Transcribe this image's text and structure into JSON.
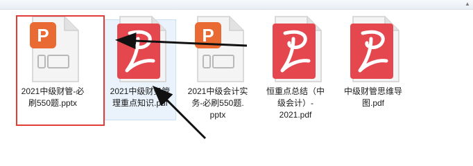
{
  "window": {
    "scroll_up_glyph": "▲"
  },
  "files": [
    {
      "name": "2021中级财管-必刷550题.pptx",
      "lines": [
        "2021中级财管-必",
        "刷550题.pptx"
      ],
      "icon": "pptx-file-icon",
      "icon_glyph": "P"
    },
    {
      "name": "2021中级财务管理重点知识.pdf",
      "lines": [
        "2021中级财务管",
        "理重点知识.pdf"
      ],
      "icon": "pdf-file-icon"
    },
    {
      "name": "2021中级会计实务-必刷550题.pptx",
      "lines": [
        "2021中级会计实",
        "务-必刷550题.",
        "pptx"
      ],
      "icon": "pptx-file-icon",
      "icon_glyph": "P"
    },
    {
      "name": "恒重点总结（中级会计）-2021.pdf",
      "lines": [
        "恒重点总结（中",
        "级会计）-",
        "2021.pdf"
      ],
      "icon": "pdf-file-icon"
    },
    {
      "name": "中级财管思维导图.pdf",
      "lines": [
        "中级财管思维导",
        "图.pdf"
      ],
      "icon": "pdf-file-icon"
    }
  ],
  "colors": {
    "pptx_accent": "#ea6a33",
    "pdf_accent": "#e5474f",
    "highlight_frame": "#e23c36",
    "arrow": "#111111"
  }
}
